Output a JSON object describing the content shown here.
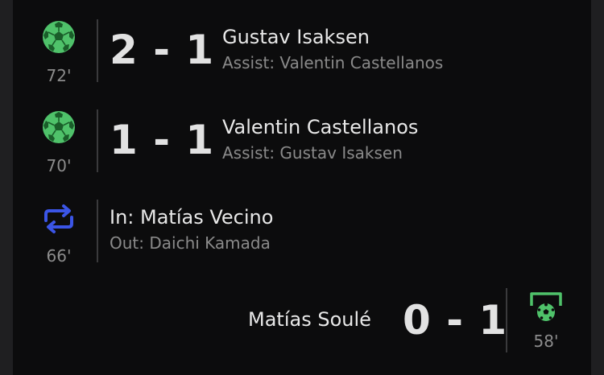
{
  "events": [
    {
      "type": "goal",
      "minute": "72'",
      "score": "2 - 1",
      "player": "Gustav Isaksen",
      "detail": "Assist: Valentin Castellanos",
      "icon": "soccer-ball-icon"
    },
    {
      "type": "goal",
      "minute": "70'",
      "score": "1 - 1",
      "player": "Valentin Castellanos",
      "detail": "Assist: Gustav Isaksen",
      "icon": "soccer-ball-icon"
    },
    {
      "type": "substitution",
      "minute": "66'",
      "player_in": "In: Matías Vecino",
      "player_out": "Out: Daichi Kamada",
      "icon": "substitution-arrows-icon"
    },
    {
      "type": "goal-away",
      "minute": "58'",
      "score": "0 - 1",
      "player": "Matías Soulé",
      "icon": "goal-net-ball-icon"
    }
  ],
  "colors": {
    "goal_green": "#4fc26a",
    "sub_blue": "#3b55e6",
    "background": "#0c0c0d"
  }
}
